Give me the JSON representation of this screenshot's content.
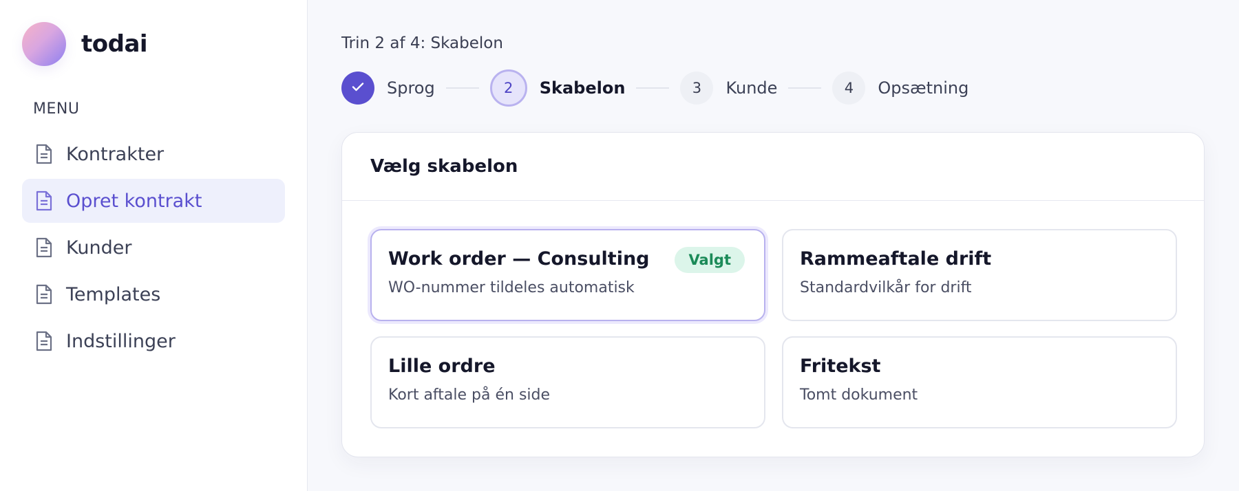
{
  "brand": {
    "name": "todai"
  },
  "sidebar": {
    "menu_heading": "MENU",
    "items": [
      {
        "label": "Kontrakter",
        "icon": "document-icon",
        "active": false
      },
      {
        "label": "Opret kontrakt",
        "icon": "document-icon",
        "active": true
      },
      {
        "label": "Kunder",
        "icon": "document-icon",
        "active": false
      },
      {
        "label": "Templates",
        "icon": "document-icon",
        "active": false
      },
      {
        "label": "Indstillinger",
        "icon": "document-icon",
        "active": false
      }
    ]
  },
  "wizard": {
    "caption": "Trin 2 af 4: Skabelon",
    "steps": [
      {
        "number": "1",
        "label": "Sprog",
        "state": "done",
        "icon": "check-icon"
      },
      {
        "number": "2",
        "label": "Skabelon",
        "state": "current"
      },
      {
        "number": "3",
        "label": "Kunde",
        "state": "upcoming"
      },
      {
        "number": "4",
        "label": "Opsætning",
        "state": "upcoming"
      }
    ]
  },
  "card": {
    "title": "Vælg skabelon",
    "templates": [
      {
        "title": "Work order — Consulting",
        "description": "WO-nummer tildeles automatisk",
        "selected": true,
        "badge": "Valgt"
      },
      {
        "title": "Rammeaftale drift",
        "description": "Standardvilkår for drift",
        "selected": false
      },
      {
        "title": "Lille ordre",
        "description": "Kort aftale på én side",
        "selected": false
      },
      {
        "title": "Fritekst",
        "description": "Tomt dokument",
        "selected": false
      }
    ]
  },
  "colors": {
    "accent": "#5a4fcf",
    "active_nav_bg": "#eef0fc",
    "badge_bg": "#dcf5ea",
    "badge_text": "#1b8a58"
  }
}
